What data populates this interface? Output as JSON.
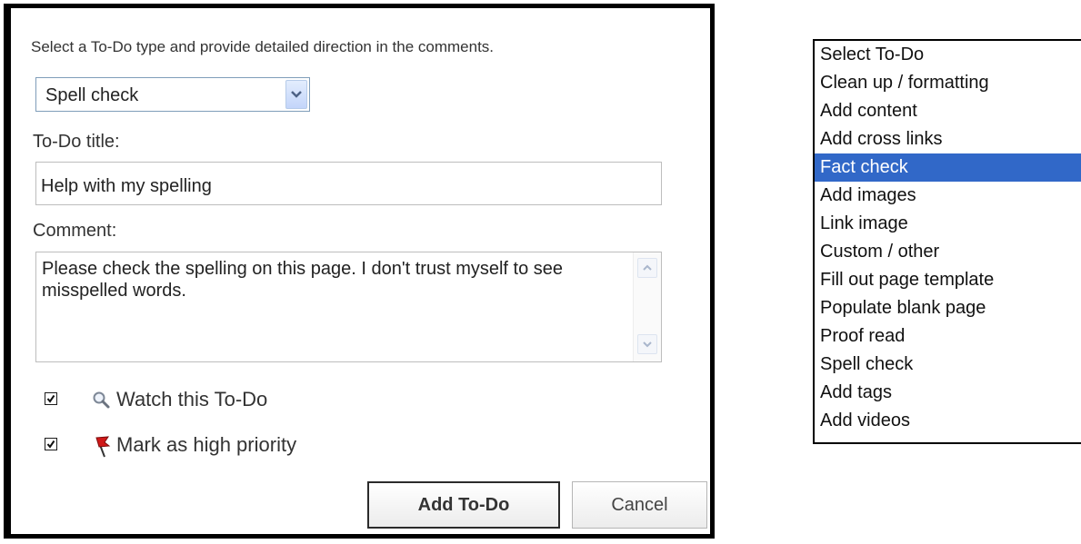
{
  "dialog": {
    "instruction": "Select a To-Do type and provide detailed direction in the comments.",
    "type_select": {
      "value": "Spell check"
    },
    "title_label": "To-Do title:",
    "title_value": "Help with my spelling",
    "comment_label": "Comment:",
    "comment_value": "Please check the spelling on this page. I don't trust myself to see misspelled words.",
    "watch": {
      "label": "Watch this To-Do",
      "checked": true,
      "icon": "magnifier-icon"
    },
    "priority": {
      "label": "Mark as high priority",
      "checked": true,
      "icon": "red-flag-icon"
    },
    "add_button": "Add To-Do",
    "cancel_button": "Cancel"
  },
  "todo_types": {
    "items": [
      "Select To-Do",
      "Clean up / formatting",
      "Add content",
      "Add cross links",
      "Fact check",
      "Add images",
      "Link image",
      "Custom / other",
      "Fill out page template",
      "Populate blank page",
      "Proof read",
      "Spell check",
      "Add tags",
      "Add videos"
    ],
    "highlighted": "Fact check"
  },
  "colors": {
    "highlight": "#3168c8",
    "flag": "#d01818"
  }
}
